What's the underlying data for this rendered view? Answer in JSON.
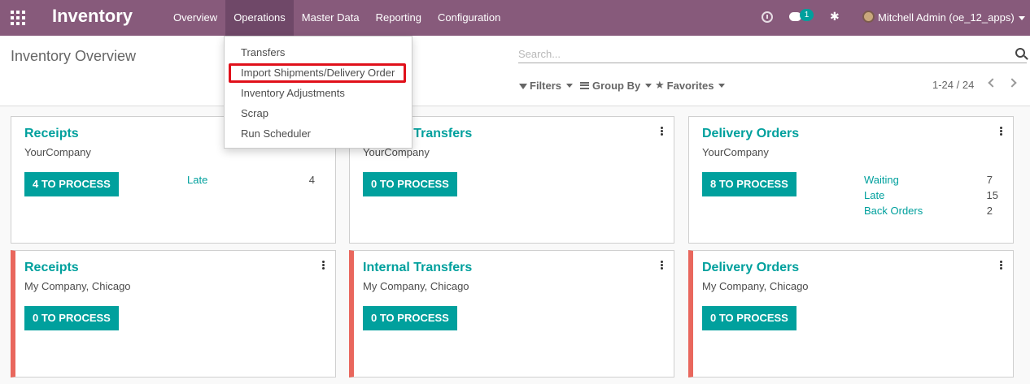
{
  "nav": {
    "brand": "Inventory",
    "menu": [
      "Overview",
      "Operations",
      "Master Data",
      "Reporting",
      "Configuration"
    ],
    "active_menu": "Operations",
    "chat_badge": "1",
    "user": "Mitchell Admin (oe_12_apps)"
  },
  "control": {
    "breadcrumb": "Inventory Overview",
    "search_placeholder": "Search...",
    "filters": "Filters",
    "group_by": "Group By",
    "favorites": "Favorites",
    "pager": "1-24 / 24"
  },
  "operations_dropdown": {
    "items": [
      "Transfers",
      "Import Shipments/Delivery Order",
      "Inventory Adjustments",
      "Scrap",
      "Run Scheduler"
    ],
    "highlighted": "Import Shipments/Delivery Order"
  },
  "cards": [
    {
      "title": "Receipts",
      "company": "YourCompany",
      "button": "4 TO PROCESS",
      "stats": [
        {
          "label": "Late",
          "value": "4"
        }
      ]
    },
    {
      "title": "Internal Transfers",
      "company": "YourCompany",
      "button": "0 TO PROCESS",
      "stats": []
    },
    {
      "title": "Delivery Orders",
      "company": "YourCompany",
      "button": "8 TO PROCESS",
      "stats": [
        {
          "label": "Waiting",
          "value": "7"
        },
        {
          "label": "Late",
          "value": "15"
        },
        {
          "label": "Back Orders",
          "value": "2"
        }
      ]
    },
    {
      "title": "Receipts",
      "company": "My Company, Chicago",
      "button": "0 TO PROCESS",
      "stats": []
    },
    {
      "title": "Internal Transfers",
      "company": "My Company, Chicago",
      "button": "0 TO PROCESS",
      "stats": []
    },
    {
      "title": "Delivery Orders",
      "company": "My Company, Chicago",
      "button": "0 TO PROCESS",
      "stats": []
    }
  ],
  "colors": {
    "navbar": "#875a7b",
    "accent": "#00a09d",
    "warning_border": "#e9675d",
    "highlight": "#e0101a"
  }
}
